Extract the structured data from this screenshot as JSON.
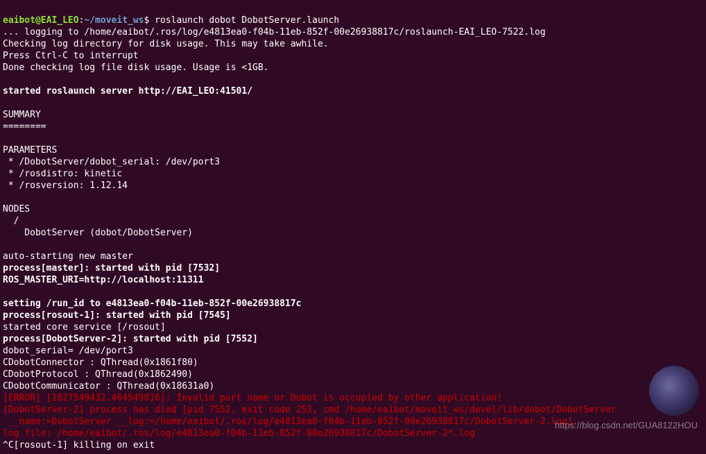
{
  "prompt": {
    "user_host": "eaibot@EAI_LEO",
    "colon": ":",
    "cwd": "~/moveit_ws",
    "dollar": "$ ",
    "command": "roslaunch dobot DobotServer.launch"
  },
  "lines": {
    "l1": "... logging to /home/eaibot/.ros/log/e4813ea0-f04b-11eb-852f-00e26938817c/roslaunch-EAI_LEO-7522.log",
    "l2": "Checking log directory for disk usage. This may take awhile.",
    "l3": "Press Ctrl-C to interrupt",
    "l4": "Done checking log file disk usage. Usage is <1GB.",
    "l5": "",
    "l6": "started roslaunch server http://EAI_LEO:41501/",
    "l7": "",
    "l8": "SUMMARY",
    "l9": "========",
    "l10": "",
    "l11": "PARAMETERS",
    "l12": " * /DobotServer/dobot_serial: /dev/port3",
    "l13": " * /rosdistro: kinetic",
    "l14": " * /rosversion: 1.12.14",
    "l15": "",
    "l16": "NODES",
    "l17": "  /",
    "l18": "    DobotServer (dobot/DobotServer)",
    "l19": "",
    "l20": "auto-starting new master",
    "l21": "process[master]: started with pid [7532]",
    "l22": "ROS_MASTER_URI=http://localhost:11311",
    "l23": "",
    "l24": "setting /run_id to e4813ea0-f04b-11eb-852f-00e26938817c",
    "l25": "process[rosout-1]: started with pid [7545]",
    "l26": "started core service [/rosout]",
    "l27": "process[DobotServer-2]: started with pid [7552]",
    "l28": "dobot_serial= /dev/port3",
    "l29": "CDobotConnector : QThread(0x1861f80)",
    "l30": "CDobotProtocol : QThread(0x1862490)",
    "l31": "CDobotCommunicator : QThread(0x18631a0)",
    "l32": "[ERROR] [1627549432.464549816]: Invalid port name or Dobot is occupied by other application!",
    "l33": "[DobotServer-2] process has died [pid 7552, exit code 253, cmd /home/eaibot/moveit_ws/devel/lib/dobot/DobotServer",
    "l34": " __name:=DobotServer __log:=/home/eaibot/.ros/log/e4813ea0-f04b-11eb-852f-00e26938817c/DobotServer-2.log].",
    "l35": "log file: /home/eaibot/.ros/log/e4813ea0-f04b-11eb-852f-00e26938817c/DobotServer-2*.log",
    "l36": "^C[rosout-1] killing on exit"
  },
  "watermark": "https://blog.csdn.net/GUA8122HOU"
}
